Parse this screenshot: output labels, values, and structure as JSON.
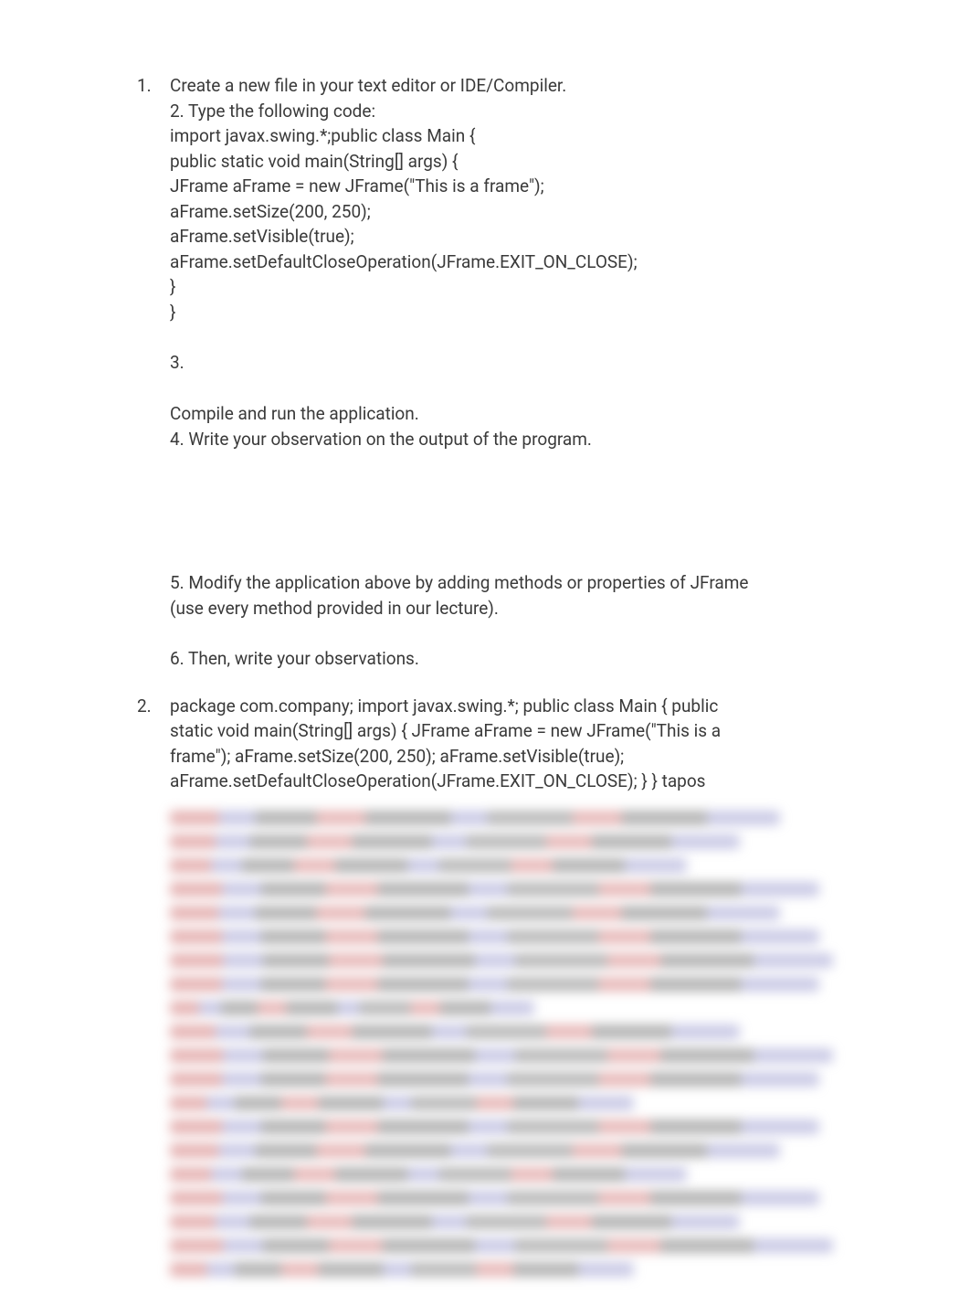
{
  "items": [
    {
      "marker": "1.",
      "lines_block1": [
        "Create a new file in your text editor or IDE/Compiler.",
        "2. Type the following code:",
        " import javax.swing.*;public class Main {",
        "public static void main(String[] args) {",
        "JFrame aFrame = new JFrame(\"This is a frame\");",
        "aFrame.setSize(200, 250);",
        "aFrame.setVisible(true);",
        "aFrame.setDefaultCloseOperation(JFrame.EXIT_ON_CLOSE);",
        "}",
        "}"
      ],
      "line_3": "3.",
      "lines_block2": [
        "Compile and run the application.",
        "4. Write your observation on the output of the program."
      ],
      "lines_block3": [
        "5. Modify the application above by adding methods or properties of JFrame",
        "(use every method provided in our lecture)."
      ],
      "line_6": "6. Then, write your observations."
    },
    {
      "marker": "2.",
      "lines": [
        "package com.company; import javax.swing.*; public class Main { public",
        "static void main(String[] args) { JFrame aFrame = new JFrame(\"This is a",
        "frame\"); aFrame.setSize(200, 250); aFrame.setVisible(true);",
        "aFrame.setDefaultCloseOperation(JFrame.EXIT_ON_CLOSE); } } tapos"
      ]
    }
  ]
}
